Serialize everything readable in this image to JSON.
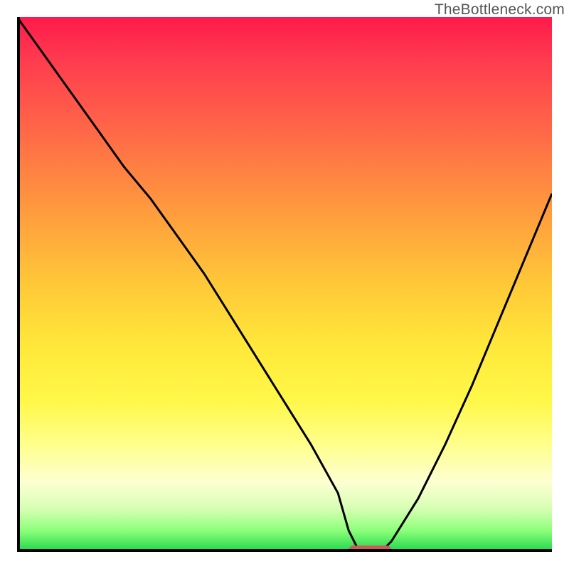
{
  "watermark": "TheBottleneck.com",
  "chart_data": {
    "type": "line",
    "title": "",
    "xlabel": "",
    "ylabel": "",
    "xlim": [
      0,
      100
    ],
    "ylim": [
      0,
      100
    ],
    "grid": false,
    "legend": false,
    "background_gradient_stops": [
      {
        "pos": 0,
        "color": "#ff1a4b"
      },
      {
        "pos": 8,
        "color": "#ff3b4f"
      },
      {
        "pos": 22,
        "color": "#ff6a47"
      },
      {
        "pos": 36,
        "color": "#ff9a3e"
      },
      {
        "pos": 50,
        "color": "#ffc838"
      },
      {
        "pos": 62,
        "color": "#ffe93a"
      },
      {
        "pos": 72,
        "color": "#fff84a"
      },
      {
        "pos": 80,
        "color": "#ffff8c"
      },
      {
        "pos": 87,
        "color": "#fdffd2"
      },
      {
        "pos": 92,
        "color": "#d6ffb3"
      },
      {
        "pos": 96,
        "color": "#8cff7a"
      },
      {
        "pos": 100,
        "color": "#1dd64a"
      }
    ],
    "series": [
      {
        "name": "bottleneck-curve",
        "x": [
          0,
          5,
          10,
          15,
          20,
          25,
          30,
          35,
          40,
          45,
          50,
          55,
          60,
          62,
          64,
          66,
          68,
          70,
          75,
          80,
          85,
          90,
          95,
          100
        ],
        "y": [
          100,
          93,
          86,
          79,
          72,
          66,
          59,
          52,
          44,
          36,
          28,
          20,
          11,
          4,
          0,
          0,
          0,
          2,
          10,
          20,
          31,
          43,
          55,
          67
        ],
        "color": "#000000",
        "stroke_width": 3
      }
    ],
    "marker": {
      "name": "optimal-range-marker",
      "x_start": 62,
      "x_end": 70,
      "y": 0,
      "color": "#cc5a5a",
      "shape": "rounded-bar"
    },
    "notes": "x and y are percentages of the plot area; y=0 is the bottom axis. Values estimated from pixel positions — chart has no tick labels."
  }
}
